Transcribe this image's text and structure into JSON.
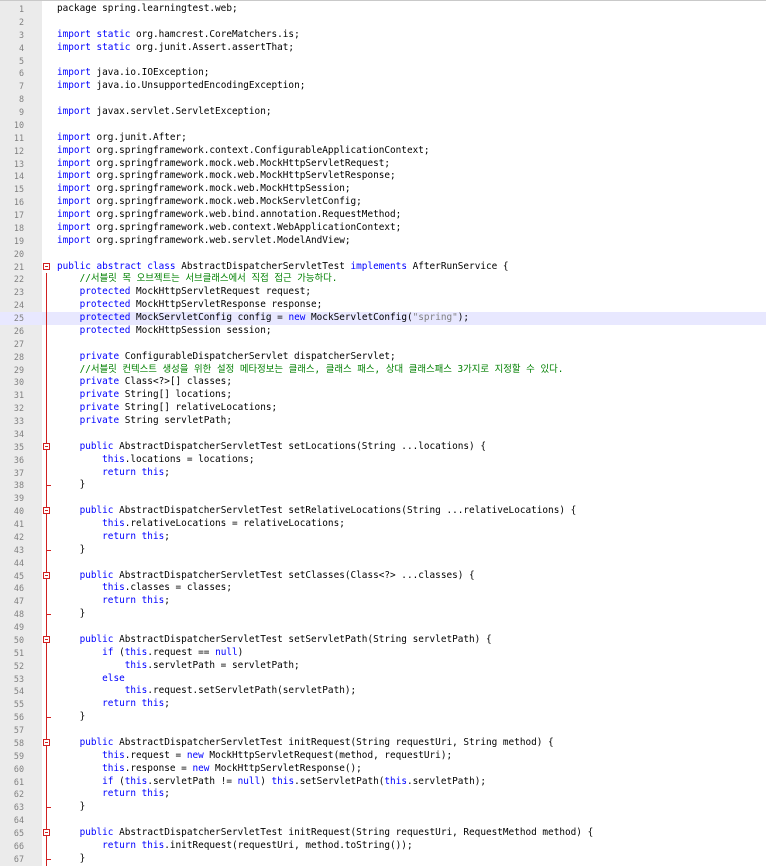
{
  "editor": {
    "lines": [
      {
        "n": "1",
        "s": [
          {
            "t": "package spring.learningtest.web;",
            "c": ""
          }
        ]
      },
      {
        "n": "2",
        "s": []
      },
      {
        "n": "3",
        "s": [
          {
            "t": "import static ",
            "c": "kw"
          },
          {
            "t": "org.hamcrest.CoreMatchers.is;",
            "c": ""
          }
        ]
      },
      {
        "n": "4",
        "s": [
          {
            "t": "import static ",
            "c": "kw"
          },
          {
            "t": "org.junit.Assert.assertThat;",
            "c": ""
          }
        ]
      },
      {
        "n": "5",
        "s": []
      },
      {
        "n": "6",
        "s": [
          {
            "t": "import ",
            "c": "kw"
          },
          {
            "t": "java.io.IOException;",
            "c": ""
          }
        ]
      },
      {
        "n": "7",
        "s": [
          {
            "t": "import ",
            "c": "kw"
          },
          {
            "t": "java.io.UnsupportedEncodingException;",
            "c": ""
          }
        ]
      },
      {
        "n": "8",
        "s": []
      },
      {
        "n": "9",
        "s": [
          {
            "t": "import ",
            "c": "kw"
          },
          {
            "t": "javax.servlet.ServletException;",
            "c": ""
          }
        ]
      },
      {
        "n": "10",
        "s": []
      },
      {
        "n": "11",
        "s": [
          {
            "t": "import ",
            "c": "kw"
          },
          {
            "t": "org.junit.After;",
            "c": ""
          }
        ]
      },
      {
        "n": "12",
        "s": [
          {
            "t": "import ",
            "c": "kw"
          },
          {
            "t": "org.springframework.context.ConfigurableApplicationContext;",
            "c": ""
          }
        ]
      },
      {
        "n": "13",
        "s": [
          {
            "t": "import ",
            "c": "kw"
          },
          {
            "t": "org.springframework.mock.web.MockHttpServletRequest;",
            "c": ""
          }
        ]
      },
      {
        "n": "14",
        "s": [
          {
            "t": "import ",
            "c": "kw"
          },
          {
            "t": "org.springframework.mock.web.MockHttpServletResponse;",
            "c": ""
          }
        ]
      },
      {
        "n": "15",
        "s": [
          {
            "t": "import ",
            "c": "kw"
          },
          {
            "t": "org.springframework.mock.web.MockHttpSession;",
            "c": ""
          }
        ]
      },
      {
        "n": "16",
        "s": [
          {
            "t": "import ",
            "c": "kw"
          },
          {
            "t": "org.springframework.mock.web.MockServletConfig;",
            "c": ""
          }
        ]
      },
      {
        "n": "17",
        "s": [
          {
            "t": "import ",
            "c": "kw"
          },
          {
            "t": "org.springframework.web.bind.annotation.RequestMethod;",
            "c": ""
          }
        ]
      },
      {
        "n": "18",
        "s": [
          {
            "t": "import ",
            "c": "kw"
          },
          {
            "t": "org.springframework.web.context.WebApplicationContext;",
            "c": ""
          }
        ]
      },
      {
        "n": "19",
        "s": [
          {
            "t": "import ",
            "c": "kw"
          },
          {
            "t": "org.springframework.web.servlet.ModelAndView;",
            "c": ""
          }
        ]
      },
      {
        "n": "20",
        "s": []
      },
      {
        "n": "21",
        "fold": "start",
        "s": [
          {
            "t": "public abstract class ",
            "c": "kw"
          },
          {
            "t": "AbstractDispatcherServletTest ",
            "c": ""
          },
          {
            "t": "implements ",
            "c": "kw"
          },
          {
            "t": "AfterRunService {",
            "c": ""
          }
        ]
      },
      {
        "n": "22",
        "fold": "mid",
        "s": [
          {
            "t": "    //서블릿 목 오브젝트는 서브클래스에서 직접 접근 가능하다.",
            "c": "cm"
          }
        ]
      },
      {
        "n": "23",
        "fold": "mid",
        "s": [
          {
            "t": "    protected ",
            "c": "kw"
          },
          {
            "t": "MockHttpServletRequest request;",
            "c": ""
          }
        ]
      },
      {
        "n": "24",
        "fold": "mid",
        "s": [
          {
            "t": "    protected ",
            "c": "kw"
          },
          {
            "t": "MockHttpServletResponse response;",
            "c": ""
          }
        ]
      },
      {
        "n": "25",
        "fold": "mid",
        "current": true,
        "s": [
          {
            "t": "    protected ",
            "c": "kw"
          },
          {
            "t": "MockServletConfig config = ",
            "c": ""
          },
          {
            "t": "new ",
            "c": "kw"
          },
          {
            "t": "MockServletConfig(",
            "c": ""
          },
          {
            "t": "\"spring\"",
            "c": "st"
          },
          {
            "t": ");",
            "c": ""
          }
        ]
      },
      {
        "n": "26",
        "fold": "mid",
        "s": [
          {
            "t": "    protected ",
            "c": "kw"
          },
          {
            "t": "MockHttpSession session;",
            "c": ""
          }
        ]
      },
      {
        "n": "27",
        "fold": "mid",
        "s": []
      },
      {
        "n": "28",
        "fold": "mid",
        "s": [
          {
            "t": "    private ",
            "c": "kw"
          },
          {
            "t": "ConfigurableDispatcherServlet dispatcherServlet;",
            "c": ""
          }
        ]
      },
      {
        "n": "29",
        "fold": "mid",
        "s": [
          {
            "t": "    //서블릿 컨텍스트 생성을 위한 설정 메타정보는 클래스, 클래스 패스, 상대 클래스패스 3가지로 지정할 수 있다.",
            "c": "cm"
          }
        ]
      },
      {
        "n": "30",
        "fold": "mid",
        "s": [
          {
            "t": "    private ",
            "c": "kw"
          },
          {
            "t": "Class<?>[] classes;",
            "c": ""
          }
        ]
      },
      {
        "n": "31",
        "fold": "mid",
        "s": [
          {
            "t": "    private ",
            "c": "kw"
          },
          {
            "t": "String[] locations;",
            "c": ""
          }
        ]
      },
      {
        "n": "32",
        "fold": "mid",
        "s": [
          {
            "t": "    private ",
            "c": "kw"
          },
          {
            "t": "String[] relativeLocations;",
            "c": ""
          }
        ]
      },
      {
        "n": "33",
        "fold": "mid",
        "s": [
          {
            "t": "    private ",
            "c": "kw"
          },
          {
            "t": "String servletPath;",
            "c": ""
          }
        ]
      },
      {
        "n": "34",
        "fold": "mid",
        "s": []
      },
      {
        "n": "35",
        "fold": "start",
        "s": [
          {
            "t": "    public ",
            "c": "kw"
          },
          {
            "t": "AbstractDispatcherServletTest setLocations(String ...locations) {",
            "c": ""
          }
        ]
      },
      {
        "n": "36",
        "fold": "mid",
        "s": [
          {
            "t": "        this",
            "c": "kw"
          },
          {
            "t": ".locations = locations;",
            "c": ""
          }
        ]
      },
      {
        "n": "37",
        "fold": "mid",
        "s": [
          {
            "t": "        return this",
            "c": "kw"
          },
          {
            "t": ";",
            "c": ""
          }
        ]
      },
      {
        "n": "38",
        "fold": "end",
        "s": [
          {
            "t": "    }",
            "c": ""
          }
        ]
      },
      {
        "n": "39",
        "fold": "mid",
        "s": []
      },
      {
        "n": "40",
        "fold": "start",
        "s": [
          {
            "t": "    public ",
            "c": "kw"
          },
          {
            "t": "AbstractDispatcherServletTest setRelativeLocations(String ...relativeLocations) {",
            "c": ""
          }
        ]
      },
      {
        "n": "41",
        "fold": "mid",
        "s": [
          {
            "t": "        this",
            "c": "kw"
          },
          {
            "t": ".relativeLocations = relativeLocations;",
            "c": ""
          }
        ]
      },
      {
        "n": "42",
        "fold": "mid",
        "s": [
          {
            "t": "        return this",
            "c": "kw"
          },
          {
            "t": ";",
            "c": ""
          }
        ]
      },
      {
        "n": "43",
        "fold": "end",
        "s": [
          {
            "t": "    }",
            "c": ""
          }
        ]
      },
      {
        "n": "44",
        "fold": "mid",
        "s": []
      },
      {
        "n": "45",
        "fold": "start",
        "s": [
          {
            "t": "    public ",
            "c": "kw"
          },
          {
            "t": "AbstractDispatcherServletTest setClasses(Class<?> ...classes) {",
            "c": ""
          }
        ]
      },
      {
        "n": "46",
        "fold": "mid",
        "s": [
          {
            "t": "        this",
            "c": "kw"
          },
          {
            "t": ".classes = classes;",
            "c": ""
          }
        ]
      },
      {
        "n": "47",
        "fold": "mid",
        "s": [
          {
            "t": "        return this",
            "c": "kw"
          },
          {
            "t": ";",
            "c": ""
          }
        ]
      },
      {
        "n": "48",
        "fold": "end",
        "s": [
          {
            "t": "    }",
            "c": ""
          }
        ]
      },
      {
        "n": "49",
        "fold": "mid",
        "s": []
      },
      {
        "n": "50",
        "fold": "start",
        "s": [
          {
            "t": "    public ",
            "c": "kw"
          },
          {
            "t": "AbstractDispatcherServletTest setServletPath(String servletPath) {",
            "c": ""
          }
        ]
      },
      {
        "n": "51",
        "fold": "mid",
        "s": [
          {
            "t": "        if ",
            "c": "kw"
          },
          {
            "t": "(",
            "c": ""
          },
          {
            "t": "this",
            "c": "kw"
          },
          {
            "t": ".request == ",
            "c": ""
          },
          {
            "t": "null",
            "c": "kw"
          },
          {
            "t": ")",
            "c": ""
          }
        ]
      },
      {
        "n": "52",
        "fold": "mid",
        "s": [
          {
            "t": "            this",
            "c": "kw"
          },
          {
            "t": ".servletPath = servletPath;",
            "c": ""
          }
        ]
      },
      {
        "n": "53",
        "fold": "mid",
        "s": [
          {
            "t": "        else",
            "c": "kw"
          }
        ]
      },
      {
        "n": "54",
        "fold": "mid",
        "s": [
          {
            "t": "            this",
            "c": "kw"
          },
          {
            "t": ".request.setServletPath(servletPath);",
            "c": ""
          }
        ]
      },
      {
        "n": "55",
        "fold": "mid",
        "s": [
          {
            "t": "        return this",
            "c": "kw"
          },
          {
            "t": ";",
            "c": ""
          }
        ]
      },
      {
        "n": "56",
        "fold": "end",
        "s": [
          {
            "t": "    }",
            "c": ""
          }
        ]
      },
      {
        "n": "57",
        "fold": "mid",
        "s": []
      },
      {
        "n": "58",
        "fold": "start",
        "s": [
          {
            "t": "    public ",
            "c": "kw"
          },
          {
            "t": "AbstractDispatcherServletTest initRequest(String requestUri, String method) {",
            "c": ""
          }
        ]
      },
      {
        "n": "59",
        "fold": "mid",
        "s": [
          {
            "t": "        this",
            "c": "kw"
          },
          {
            "t": ".request = ",
            "c": ""
          },
          {
            "t": "new ",
            "c": "kw"
          },
          {
            "t": "MockHttpServletRequest(method, requestUri);",
            "c": ""
          }
        ]
      },
      {
        "n": "60",
        "fold": "mid",
        "s": [
          {
            "t": "        this",
            "c": "kw"
          },
          {
            "t": ".response = ",
            "c": ""
          },
          {
            "t": "new ",
            "c": "kw"
          },
          {
            "t": "MockHttpServletResponse();",
            "c": ""
          }
        ]
      },
      {
        "n": "61",
        "fold": "mid",
        "s": [
          {
            "t": "        if ",
            "c": "kw"
          },
          {
            "t": "(",
            "c": ""
          },
          {
            "t": "this",
            "c": "kw"
          },
          {
            "t": ".servletPath != ",
            "c": ""
          },
          {
            "t": "null",
            "c": "kw"
          },
          {
            "t": ") ",
            "c": ""
          },
          {
            "t": "this",
            "c": "kw"
          },
          {
            "t": ".setServletPath(",
            "c": ""
          },
          {
            "t": "this",
            "c": "kw"
          },
          {
            "t": ".servletPath);",
            "c": ""
          }
        ]
      },
      {
        "n": "62",
        "fold": "mid",
        "s": [
          {
            "t": "        return this",
            "c": "kw"
          },
          {
            "t": ";",
            "c": ""
          }
        ]
      },
      {
        "n": "63",
        "fold": "end",
        "s": [
          {
            "t": "    }",
            "c": ""
          }
        ]
      },
      {
        "n": "64",
        "fold": "mid",
        "s": []
      },
      {
        "n": "65",
        "fold": "start",
        "s": [
          {
            "t": "    public ",
            "c": "kw"
          },
          {
            "t": "AbstractDispatcherServletTest initRequest(String requestUri, RequestMethod method) {",
            "c": ""
          }
        ]
      },
      {
        "n": "66",
        "fold": "mid",
        "s": [
          {
            "t": "        return this",
            "c": "kw"
          },
          {
            "t": ".initRequest(requestUri, method.toString());",
            "c": ""
          }
        ]
      },
      {
        "n": "67",
        "fold": "end",
        "s": [
          {
            "t": "    }",
            "c": ""
          }
        ]
      }
    ]
  }
}
